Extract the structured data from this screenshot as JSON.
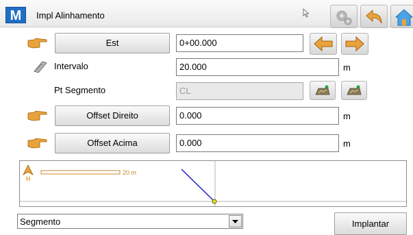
{
  "app": {
    "logo_letter": "M",
    "title": "Impl Alinhamento"
  },
  "toolbar": {
    "settings_icon": "gear-icon",
    "back_icon": "undo-arrow-icon",
    "home_icon": "home-icon"
  },
  "rows": {
    "station": {
      "button_label": "Est",
      "value": "0+00.000"
    },
    "interval": {
      "label": "Intervalo",
      "value": "20.000",
      "unit": "m"
    },
    "segment_point": {
      "label": "Pt Segmento",
      "placeholder": "CL"
    },
    "offset_right": {
      "button_label": "Offset Direito",
      "value": "0.000",
      "unit": "m"
    },
    "offset_up": {
      "button_label": "Offset Acima",
      "value": "0.000",
      "unit": "m"
    }
  },
  "graphic": {
    "scale_label": "20 m",
    "north_label": "H"
  },
  "bottom": {
    "mode_selected": "Segmento",
    "stakeout_button": "Implantar"
  },
  "colors": {
    "accent_orange": "#e8a33d",
    "line_blue": "#2020d0",
    "logo_blue": "#1e6fc4"
  }
}
